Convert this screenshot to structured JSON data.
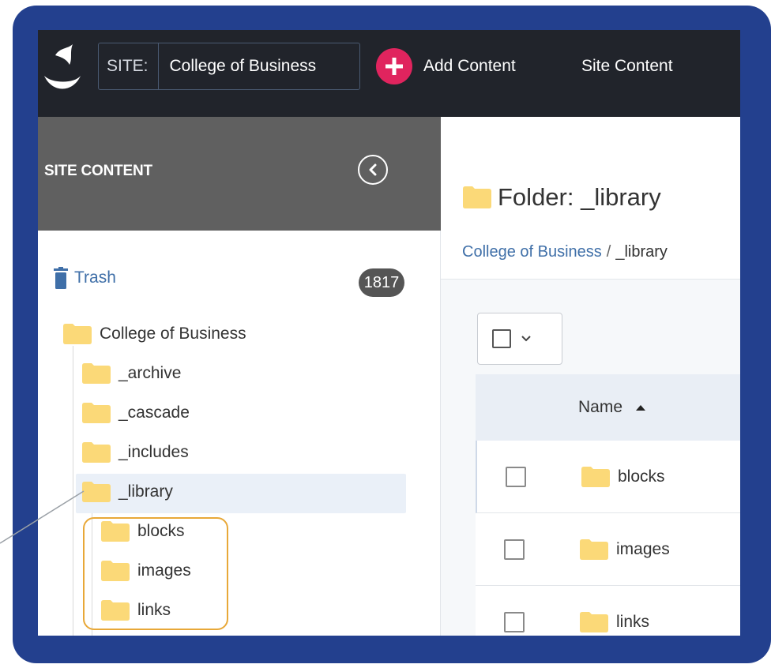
{
  "topbar": {
    "site_label": "SITE:",
    "site_name": "College of Business",
    "add_content_label": "Add Content",
    "site_content_label": "Site Content"
  },
  "sidebar": {
    "title": "SITE CONTENT",
    "trash_label": "Trash",
    "trash_count": "1817",
    "tree": {
      "root": "College of Business",
      "children": [
        "_archive",
        "_cascade",
        "_includes",
        "_library"
      ],
      "library_children": [
        "blocks",
        "images",
        "links"
      ]
    }
  },
  "main": {
    "folder_title": "Folder: _library",
    "breadcrumb": {
      "parent": "College of Business",
      "separator": "/",
      "current": "_library"
    },
    "table": {
      "name_header": "Name",
      "rows": [
        "blocks",
        "images",
        "links"
      ]
    }
  },
  "colors": {
    "frame": "#23408e",
    "topbar": "#21242b",
    "accent": "#e0245e",
    "highlight": "#e8a838",
    "folder": "#fbd978",
    "link": "#3f6fa8"
  },
  "icons": [
    "logo-icon",
    "plus-circle-icon",
    "collapse-left-icon",
    "trash-icon",
    "folder-icon",
    "checkbox-icon",
    "chevron-down-icon",
    "sort-asc-icon"
  ]
}
